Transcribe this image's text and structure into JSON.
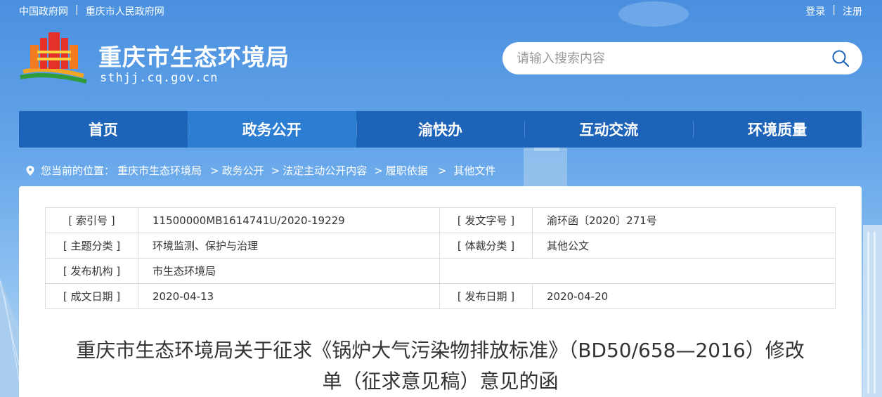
{
  "topbar": {
    "links_left": [
      "中国政府网",
      "重庆市人民政府网"
    ],
    "separator": "|",
    "links_right": [
      "登录",
      "注册"
    ]
  },
  "header": {
    "title": "重庆市生态环境局",
    "domain": "sthjj.cq.gov.cn"
  },
  "search": {
    "placeholder": "请输入搜索内容",
    "value": ""
  },
  "nav": {
    "items": [
      {
        "label": "首页"
      },
      {
        "label": "政务公开",
        "active": true
      },
      {
        "label": "渝快办"
      },
      {
        "label": "互动交流"
      },
      {
        "label": "环境质量"
      }
    ]
  },
  "breadcrumb": {
    "prefix": "您当前的位置：",
    "items": [
      "重庆市生态环境局",
      "政务公开",
      "法定主动公开内容",
      "履职依据",
      "其他文件"
    ],
    "sep": ">"
  },
  "meta": {
    "index_key": "[ 索引号 ]",
    "index_val": "11500000MB1614741U/2020-19229",
    "docno_key": "[ 发文字号 ]",
    "docno_val": "渝环函〔2020〕271号",
    "topic_key": "[ 主题分类 ]",
    "topic_val": "环境监测、保护与治理",
    "genre_key": "[ 体裁分类 ]",
    "genre_val": "其他公文",
    "org_key": "[ 发布机构 ]",
    "org_val": "市生态环境局",
    "created_key": "[ 成文日期 ]",
    "created_val": "2020-04-13",
    "pub_key": "[ 发布日期 ]",
    "pub_val": "2020-04-20"
  },
  "document": {
    "title_line1": "重庆市生态环境局关于征求《锅炉大气污染物排放标准》（BD50/658—2016）修改",
    "title_line2": "单（征求意见稿）意见的函"
  },
  "colors": {
    "nav": "#1d63b7",
    "nav_active": "#2b7ed2",
    "bg_top": "#4a90df"
  }
}
